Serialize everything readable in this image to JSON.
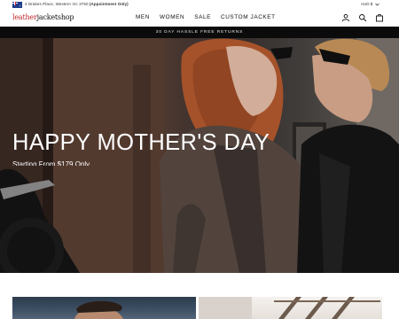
{
  "topbar": {
    "address_text": "4 Drakes Place, Western Vic 3750 ",
    "address_note": "(Appointment Only)",
    "currency": "AUD $"
  },
  "header": {
    "logo_part1": "leather",
    "logo_part2": "jacketshop",
    "nav": [
      "MEN",
      "WOMEN",
      "SALE",
      "CUSTOM JACKET"
    ]
  },
  "promo": {
    "text": "30 DAY HASSLE FREE RETURNS"
  },
  "hero": {
    "title": "HAPPY MOTHER'S DAY",
    "subtitle": "Starting From $179 Only"
  },
  "colors": {
    "logo_accent": "#c0272d",
    "promo_bg": "#0b0b0b",
    "text": "#111111"
  },
  "icons": [
    "flag-australia-icon",
    "chevron-down-icon",
    "account-icon",
    "search-icon",
    "cart-icon"
  ]
}
